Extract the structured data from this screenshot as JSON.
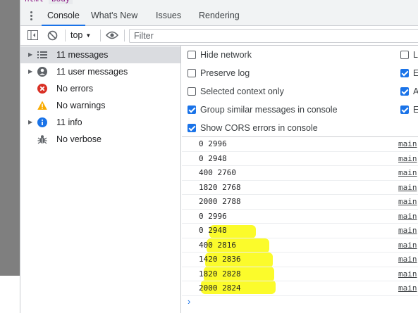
{
  "breadcrumbs": [
    "html",
    "body"
  ],
  "tabs": [
    {
      "label": "Console",
      "active": true
    },
    {
      "label": "What's New",
      "active": false
    },
    {
      "label": "Issues",
      "active": false
    },
    {
      "label": "Rendering",
      "active": false
    }
  ],
  "toolbar": {
    "context": "top",
    "filter_placeholder": "Filter"
  },
  "sidebar": {
    "items": [
      {
        "label": "11 messages",
        "icon": "list-icon",
        "expandable": true,
        "selected": true
      },
      {
        "label": "11 user messages",
        "icon": "user-icon",
        "expandable": true,
        "selected": false
      },
      {
        "label": "No errors",
        "icon": "error-icon",
        "expandable": false,
        "selected": false
      },
      {
        "label": "No warnings",
        "icon": "warning-icon",
        "expandable": false,
        "selected": false
      },
      {
        "label": "11 info",
        "icon": "info-icon",
        "expandable": true,
        "selected": false
      },
      {
        "label": "No verbose",
        "icon": "bug-icon",
        "expandable": false,
        "selected": false
      }
    ]
  },
  "settings": {
    "left": [
      {
        "label": "Hide network",
        "checked": false
      },
      {
        "label": "Preserve log",
        "checked": false
      },
      {
        "label": "Selected context only",
        "checked": false
      },
      {
        "label": "Group similar messages in console",
        "checked": true
      },
      {
        "label": "Show CORS errors in console",
        "checked": true
      }
    ],
    "right": [
      {
        "label": "Lo",
        "checked": false
      },
      {
        "label": "Ea",
        "checked": true
      },
      {
        "label": "Au",
        "checked": true
      },
      {
        "label": "Ev",
        "checked": true
      }
    ]
  },
  "logs": [
    {
      "text": "0 2996",
      "source": "main",
      "highlighted": false
    },
    {
      "text": "0 2948",
      "source": "main",
      "highlighted": false
    },
    {
      "text": "400 2760",
      "source": "main",
      "highlighted": false
    },
    {
      "text": "1820 2768",
      "source": "main",
      "highlighted": false
    },
    {
      "text": "2000 2788",
      "source": "main",
      "highlighted": false
    },
    {
      "text": "0 2996",
      "source": "main",
      "highlighted": false
    },
    {
      "text": "0 2948",
      "source": "main",
      "highlighted": true
    },
    {
      "text": "400 2816",
      "source": "main",
      "highlighted": true
    },
    {
      "text": "1420 2836",
      "source": "main",
      "highlighted": true
    },
    {
      "text": "1820 2828",
      "source": "main",
      "highlighted": true
    },
    {
      "text": "2000 2824",
      "source": "main",
      "highlighted": true
    }
  ],
  "colors": {
    "accent": "#1a73e8",
    "highlight": "#fbfb2b",
    "error": "#d93025",
    "warning": "#f9ab00"
  }
}
